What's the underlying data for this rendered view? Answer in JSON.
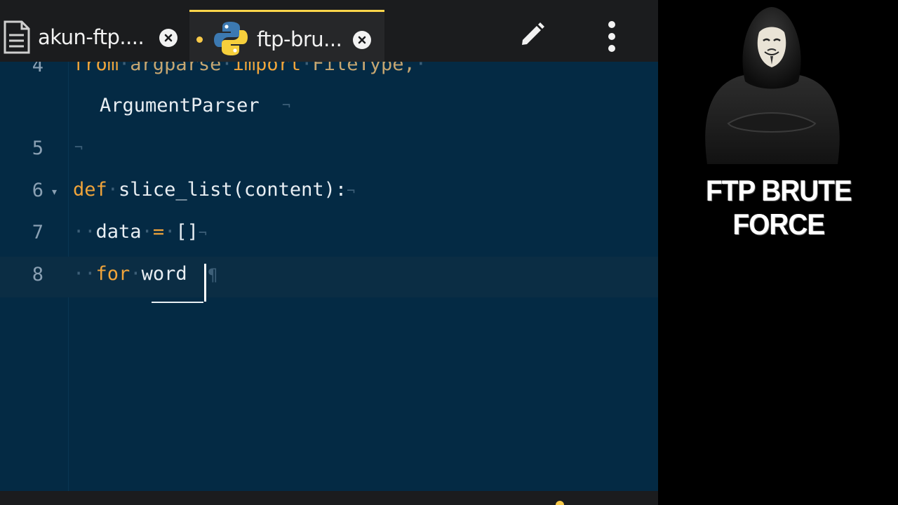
{
  "tabs": [
    {
      "label": "akun-ftp....",
      "icon": "file-text-icon",
      "active": false,
      "modified": false
    },
    {
      "label": "ftp-bru...",
      "icon": "python-icon",
      "active": true,
      "modified": true
    }
  ],
  "toolbar": {
    "edit_icon": "pencil-icon",
    "menu_icon": "more-vertical-icon"
  },
  "editor": {
    "lines": [
      {
        "number": "4",
        "text": "from argparse import FileType,",
        "continuation": "ArgumentParser"
      },
      {
        "number": "5",
        "text": ""
      },
      {
        "number": "6",
        "text": "def slice_list(content):"
      },
      {
        "number": "7",
        "text": "data = []"
      },
      {
        "number": "8",
        "text": "for word"
      }
    ]
  },
  "panel": {
    "title": "FTP BRUTE FORCE",
    "image": "anonymous-hacker-figure"
  },
  "colors": {
    "editor_bg": "#042a44",
    "tabbar_bg": "#1b1c1e",
    "keyword": "#f0a43a",
    "accent": "#ffd54a"
  }
}
